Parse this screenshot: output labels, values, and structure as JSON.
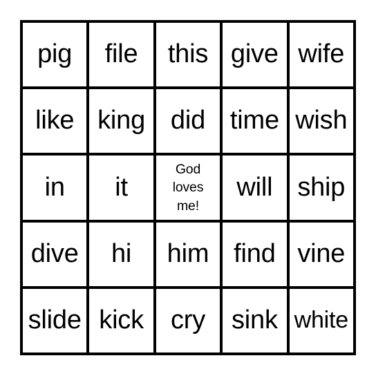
{
  "card": {
    "type": "bingo-card",
    "columns": 5,
    "rows": 5,
    "line_color": "#000000",
    "cell_color": "#ffffff",
    "background_color": "#ffffff",
    "cells": [
      {
        "text": "pig",
        "row": 1,
        "col": 1,
        "free_space": false,
        "fit": "normal"
      },
      {
        "text": "file",
        "row": 1,
        "col": 2,
        "free_space": false,
        "fit": "normal"
      },
      {
        "text": "this",
        "row": 1,
        "col": 3,
        "free_space": false,
        "fit": "normal"
      },
      {
        "text": "give",
        "row": 1,
        "col": 4,
        "free_space": false,
        "fit": "normal"
      },
      {
        "text": "wife",
        "row": 1,
        "col": 5,
        "free_space": false,
        "fit": "normal"
      },
      {
        "text": "like",
        "row": 2,
        "col": 1,
        "free_space": false,
        "fit": "normal"
      },
      {
        "text": "king",
        "row": 2,
        "col": 2,
        "free_space": false,
        "fit": "normal"
      },
      {
        "text": "did",
        "row": 2,
        "col": 3,
        "free_space": false,
        "fit": "normal"
      },
      {
        "text": "time",
        "row": 2,
        "col": 4,
        "free_space": false,
        "fit": "normal"
      },
      {
        "text": "wish",
        "row": 2,
        "col": 5,
        "free_space": false,
        "fit": "normal"
      },
      {
        "text": "in",
        "row": 3,
        "col": 1,
        "free_space": false,
        "fit": "normal"
      },
      {
        "text": "it",
        "row": 3,
        "col": 2,
        "free_space": false,
        "fit": "normal"
      },
      {
        "text": "God\nloves\nme!",
        "row": 3,
        "col": 3,
        "free_space": true,
        "fit": "normal"
      },
      {
        "text": "will",
        "row": 3,
        "col": 4,
        "free_space": false,
        "fit": "normal"
      },
      {
        "text": "ship",
        "row": 3,
        "col": 5,
        "free_space": false,
        "fit": "normal"
      },
      {
        "text": "dive",
        "row": 4,
        "col": 1,
        "free_space": false,
        "fit": "normal"
      },
      {
        "text": "hi",
        "row": 4,
        "col": 2,
        "free_space": false,
        "fit": "normal"
      },
      {
        "text": "him",
        "row": 4,
        "col": 3,
        "free_space": false,
        "fit": "normal"
      },
      {
        "text": "find",
        "row": 4,
        "col": 4,
        "free_space": false,
        "fit": "normal"
      },
      {
        "text": "vine",
        "row": 4,
        "col": 5,
        "free_space": false,
        "fit": "normal"
      },
      {
        "text": "slide",
        "row": 5,
        "col": 1,
        "free_space": false,
        "fit": "normal"
      },
      {
        "text": "kick",
        "row": 5,
        "col": 2,
        "free_space": false,
        "fit": "normal"
      },
      {
        "text": "cry",
        "row": 5,
        "col": 3,
        "free_space": false,
        "fit": "normal"
      },
      {
        "text": "sink",
        "row": 5,
        "col": 4,
        "free_space": false,
        "fit": "normal"
      },
      {
        "text": "white",
        "row": 5,
        "col": 5,
        "free_space": false,
        "fit": "small"
      }
    ]
  }
}
